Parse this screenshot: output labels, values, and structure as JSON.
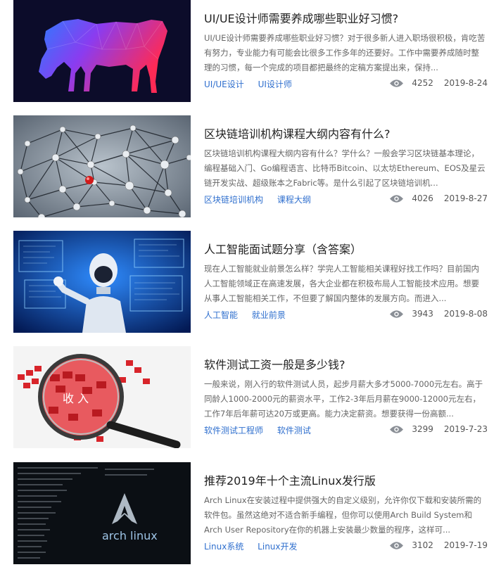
{
  "articles": [
    {
      "title": "UI/UE设计师需要养成哪些职业好习惯?",
      "desc": "UI/UE设计师需要养成哪些职业好习惯？对于很多新人进入职场很积极，肯吃苦有努力，专业能力有可能会比很多工作多年的还要好。工作中需要养成随时整理的习惯，每一个完成的项目都把最终的定稿方案提出来，保持...",
      "tags": [
        "UI/UE设计",
        "UI设计师"
      ],
      "views": "4252",
      "date": "2019-8-24",
      "image": "horse-illustration"
    },
    {
      "title": "区块链培训机构课程大纲内容有什么?",
      "desc": "区块链培训机构课程大纲内容有什么？学什么？一般会学习区块链基本理论，编程基础入门、Go编程语言、比特币Bitcoin、以太坊Ethereum、EOS及星云链开发实战、超级账本之Fabric等。是什么引起了区块链培训机...",
      "tags": [
        "区块链培训机构",
        "课程大纲"
      ],
      "views": "4026",
      "date": "2019-8-27",
      "image": "blockchain-network-sphere"
    },
    {
      "title": "人工智能面试题分享（含答案）",
      "desc": "现在人工智能就业前景怎么样？学完人工智能相关课程好找工作吗？目前国内人工智能领域正在高速发展，各大企业都在积极布局人工智能技术应用。想要从事人工智能相关工作，不但要了解国内整体的发展方向。而进入...",
      "tags": [
        "人工智能",
        "就业前景"
      ],
      "views": "3943",
      "date": "2019-8-08",
      "image": "ai-robot"
    },
    {
      "title": "软件测试工资一般是多少钱?",
      "desc": "一般来说，刚入行的软件测试人员，起步月薪大多才5000-7000元左右。高于同龄人1000-2000元的薪资水平，工作2-3年后月薪在9000-12000元左右，工作7年后年薪可达20万或更高。能力决定薪资。想要获得一份高额...",
      "tags": [
        "软件测试工程师",
        "软件测试"
      ],
      "views": "3299",
      "date": "2019-7-23",
      "image": "magnifier-income",
      "image_text": "收 入"
    },
    {
      "title": "推荐2019年十个主流Linux发行版",
      "desc": "Arch Linux在安装过程中提供强大的自定义级别，允许你仅下载和安装所需的软件包。虽然这绝对不适合新手编程，但你可以使用Arch Build System和Arch User Repository在你的机器上安装最少数量的程序，这样可...",
      "tags": [
        "Linux系统",
        "Linux开发"
      ],
      "views": "3102",
      "date": "2019-7-19",
      "image": "arch-linux-terminal",
      "image_text": "arch linux"
    }
  ]
}
